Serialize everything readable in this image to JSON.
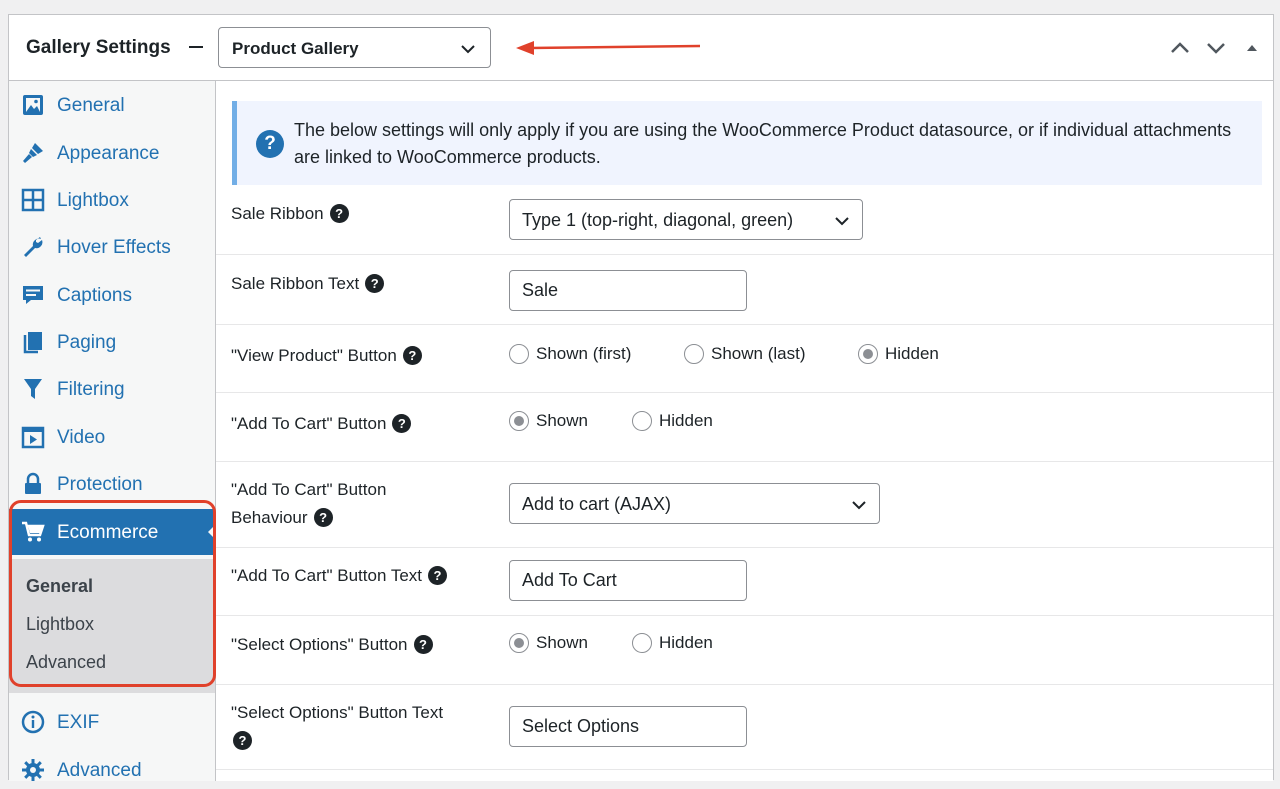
{
  "header": {
    "title": "Gallery Settings",
    "gallery_select": "Product Gallery",
    "arrow_color": "#e0412b"
  },
  "sidebar": {
    "items": [
      {
        "label": "General",
        "icon": "image-icon"
      },
      {
        "label": "Appearance",
        "icon": "brush-icon"
      },
      {
        "label": "Lightbox",
        "icon": "grid-icon"
      },
      {
        "label": "Hover Effects",
        "icon": "wrench-icon"
      },
      {
        "label": "Captions",
        "icon": "caption-icon"
      },
      {
        "label": "Paging",
        "icon": "pages-icon"
      },
      {
        "label": "Filtering",
        "icon": "filter-icon"
      },
      {
        "label": "Video",
        "icon": "video-icon"
      },
      {
        "label": "Protection",
        "icon": "lock-icon"
      },
      {
        "label": "Ecommerce",
        "icon": "cart-icon"
      },
      {
        "label": "EXIF",
        "icon": "info-icon"
      },
      {
        "label": "Advanced",
        "icon": "gear-icon"
      }
    ],
    "submenu": [
      "General",
      "Lightbox",
      "Advanced"
    ],
    "active_color": "#2271b1"
  },
  "notice": {
    "text": "The below settings will only apply if you are using the WooCommerce Product datasource, or if individual attachments are linked to WooCommerce products."
  },
  "settings": {
    "sale_ribbon": {
      "label": "Sale Ribbon",
      "value": "Type 1 (top-right, diagonal, green)"
    },
    "sale_ribbon_text": {
      "label": "Sale Ribbon Text",
      "value": "Sale"
    },
    "view_product": {
      "label": "\"View Product\" Button",
      "options": [
        "Shown (first)",
        "Shown (last)",
        "Hidden"
      ],
      "selected": "Hidden"
    },
    "add_to_cart": {
      "label": "\"Add To Cart\" Button",
      "options": [
        "Shown",
        "Hidden"
      ],
      "selected": "Shown"
    },
    "add_to_cart_behaviour": {
      "label_line1": "\"Add To Cart\" Button",
      "label_line2": "Behaviour",
      "value": "Add to cart (AJAX)"
    },
    "add_to_cart_text": {
      "label": "\"Add To Cart\" Button Text",
      "value": "Add To Cart"
    },
    "select_options": {
      "label": "\"Select Options\" Button",
      "options": [
        "Shown",
        "Hidden"
      ],
      "selected": "Shown"
    },
    "select_options_text": {
      "label": "\"Select Options\" Button Text",
      "value": "Select Options"
    }
  }
}
